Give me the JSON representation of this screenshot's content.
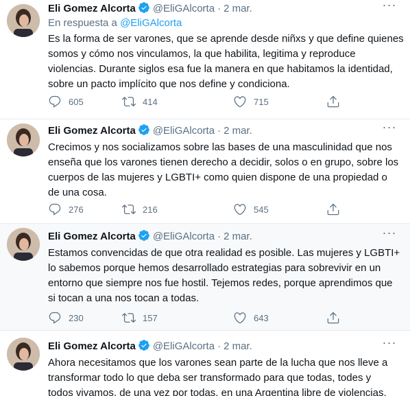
{
  "tweets": [
    {
      "name": "Eli Gomez Alcorta",
      "handle": "@EliGAlcorta",
      "dot": "·",
      "date": "2 mar.",
      "reply_prefix": "En respuesta a",
      "reply_handle": "@EliGAlcorta",
      "text": "Es la forma de ser varones, que se aprende desde niñxs y que define quienes\nsomos y cómo nos vinculamos, la que habilita, legitima y reproduce\nviolencias. Durante siglos esa fue la manera en que habitamos la identidad,\nsobre un pacto implícito que nos define y condiciona.",
      "replies": "605",
      "retweets": "414",
      "likes": "715"
    },
    {
      "name": "Eli Gomez Alcorta",
      "handle": "@EliGAlcorta",
      "dot": "·",
      "date": "2 mar.",
      "text": "Crecimos y nos socializamos sobre las bases de una masculinidad que nos\nenseña que los varones tienen derecho a decidir, solos o en grupo, sobre los\ncuerpos de las mujeres y LGBTI+ como quien dispone de una propiedad o\nde una cosa.",
      "replies": "276",
      "retweets": "216",
      "likes": "545"
    },
    {
      "name": "Eli Gomez Alcorta",
      "handle": "@EliGAlcorta",
      "dot": "·",
      "date": "2 mar.",
      "text": "Estamos convencidas de que otra realidad es posible. Las mujeres y LGBTI+\nlo sabemos porque hemos desarrollado estrategias para sobrevivir en un\nentorno que siempre nos fue hostil. Tejemos redes, porque aprendimos que\nsi tocan a una nos tocan a todas.",
      "replies": "230",
      "retweets": "157",
      "likes": "643"
    },
    {
      "name": "Eli Gomez Alcorta",
      "handle": "@EliGAlcorta",
      "dot": "·",
      "date": "2 mar.",
      "text": "Ahora necesitamos que los varones sean parte de la lucha que nos lleve a\ntransformar todo lo que deba ser transformado para que todas, todes y\ntodos vivamos, de una vez por todas, en una Argentina libre de violencias."
    }
  ],
  "icons": {
    "reply": "reply-icon",
    "retweet": "retweet-icon",
    "like": "heart-icon",
    "share": "share-icon",
    "verified": "verified-badge-icon",
    "more": "more-icon"
  },
  "colors": {
    "accent": "#1da1f2",
    "muted": "#5b7083",
    "text": "#0f1419",
    "divider": "#e6ecf0",
    "highlight_bg": "#f7f9fa"
  }
}
